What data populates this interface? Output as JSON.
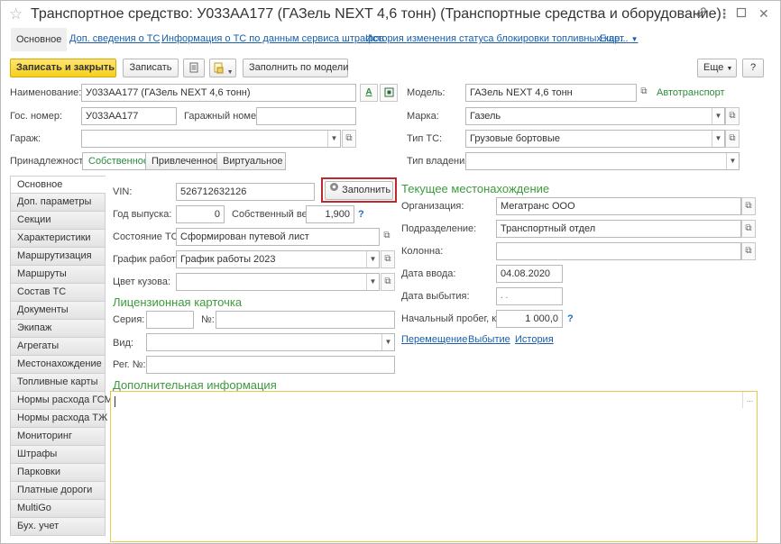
{
  "window": {
    "title": "Транспортное средство: У033АА177 (ГАЗель NEXT 4,6 тонн) (Транспортные средства и оборудование)",
    "star_glyph": "☆",
    "link_glyph": "🔗",
    "menu_glyph": "⋮",
    "min_glyph": "▭",
    "close_glyph": "✕"
  },
  "nav_tabs": [
    {
      "label": "Основное"
    },
    {
      "label": "Доп. сведения о ТС"
    },
    {
      "label": "Информация о ТС по данным сервиса штрафов"
    },
    {
      "label": "История изменения статуса блокировки топливных карт"
    },
    {
      "label": "Еще..."
    }
  ],
  "toolbar": {
    "save_close": "Записать и закрыть",
    "save": "Записать",
    "fill_by_model": "Заполнить по модели",
    "more": "Еще",
    "help": "?"
  },
  "header": {
    "name_label": "Наименование:",
    "name_value": "У033АА177 (ГАЗель NEXT 4,6 тонн)",
    "gos_label": "Гос. номер:",
    "gos_value": "У033АА177",
    "garage_num_label": "Гаражный номер:",
    "garage_num_value": "",
    "garage_label": "Гараж:",
    "garage_value": "",
    "belong_label": "Принадлежность:",
    "belong_options": [
      "Собственное",
      "Привлеченное",
      "Виртуальное"
    ],
    "model_label": "Модель:",
    "model_value": "ГАЗель NEXT 4,6 тонн",
    "model_type": "Автотранспорт",
    "brand_label": "Марка:",
    "brand_value": "Газель",
    "type_label": "Тип ТС:",
    "type_value": "Грузовые бортовые",
    "own_type_label": "Тип владения:",
    "own_type_value": ""
  },
  "sidebar": {
    "items": [
      {
        "label": "Основное"
      },
      {
        "label": "Доп. параметры"
      },
      {
        "label": "Секции"
      },
      {
        "label": "Характеристики"
      },
      {
        "label": "Маршрутизация"
      },
      {
        "label": "Маршруты"
      },
      {
        "label": "Состав ТС"
      },
      {
        "label": "Документы"
      },
      {
        "label": "Экипаж"
      },
      {
        "label": "Агрегаты"
      },
      {
        "label": "Местонахождение"
      },
      {
        "label": "Топливные карты"
      },
      {
        "label": "Нормы расхода ГСМ"
      },
      {
        "label": "Нормы расхода ТЖ"
      },
      {
        "label": "Мониторинг"
      },
      {
        "label": "Штрафы"
      },
      {
        "label": "Парковки"
      },
      {
        "label": "Платные дороги"
      },
      {
        "label": "MultiGo"
      },
      {
        "label": "Бух. учет"
      }
    ]
  },
  "main": {
    "vin_label": "VIN:",
    "vin_value": "526712632126",
    "fill_button": "Заполнить",
    "year_label": "Год выпуска:",
    "year_value": "0",
    "weight_label": "Собственный вес:",
    "weight_value": "1,900",
    "state_label": "Состояние ТС:",
    "state_value": "Сформирован путевой лист",
    "schedule_label": "График работы:",
    "schedule_value": "График работы 2023",
    "color_label": "Цвет кузова:",
    "color_value": "",
    "license_title": "Лицензионная карточка",
    "series_label": "Серия:",
    "series_value": "",
    "num_label": "№:",
    "num_value": "",
    "kind_label": "Вид:",
    "kind_value": "",
    "reg_label": "Рег. №:",
    "reg_value": "",
    "extra_title": "Дополнительная информация",
    "extra_value": ""
  },
  "location": {
    "title": "Текущее местонахождение",
    "org_label": "Организация:",
    "org_value": "Мегатранс ООО",
    "dept_label": "Подразделение:",
    "dept_value": "Транспортный отдел",
    "column_label": "Колонна:",
    "column_value": "",
    "date_in_label": "Дата ввода:",
    "date_in_value": "04.08.2020",
    "date_out_label": "Дата выбытия:",
    "date_out_value": " .  .",
    "mileage_label": "Начальный пробег, км:",
    "mileage_value": "1 000,0",
    "links": [
      "Перемещение",
      "Выбытие",
      "История"
    ]
  },
  "colors": {
    "accent_yellow": "#f7cf1d",
    "section_green": "#3d9a3d",
    "link_blue": "#1a5ea8",
    "highlight_red": "#c0282d",
    "extra_border": "#e8c84a"
  }
}
